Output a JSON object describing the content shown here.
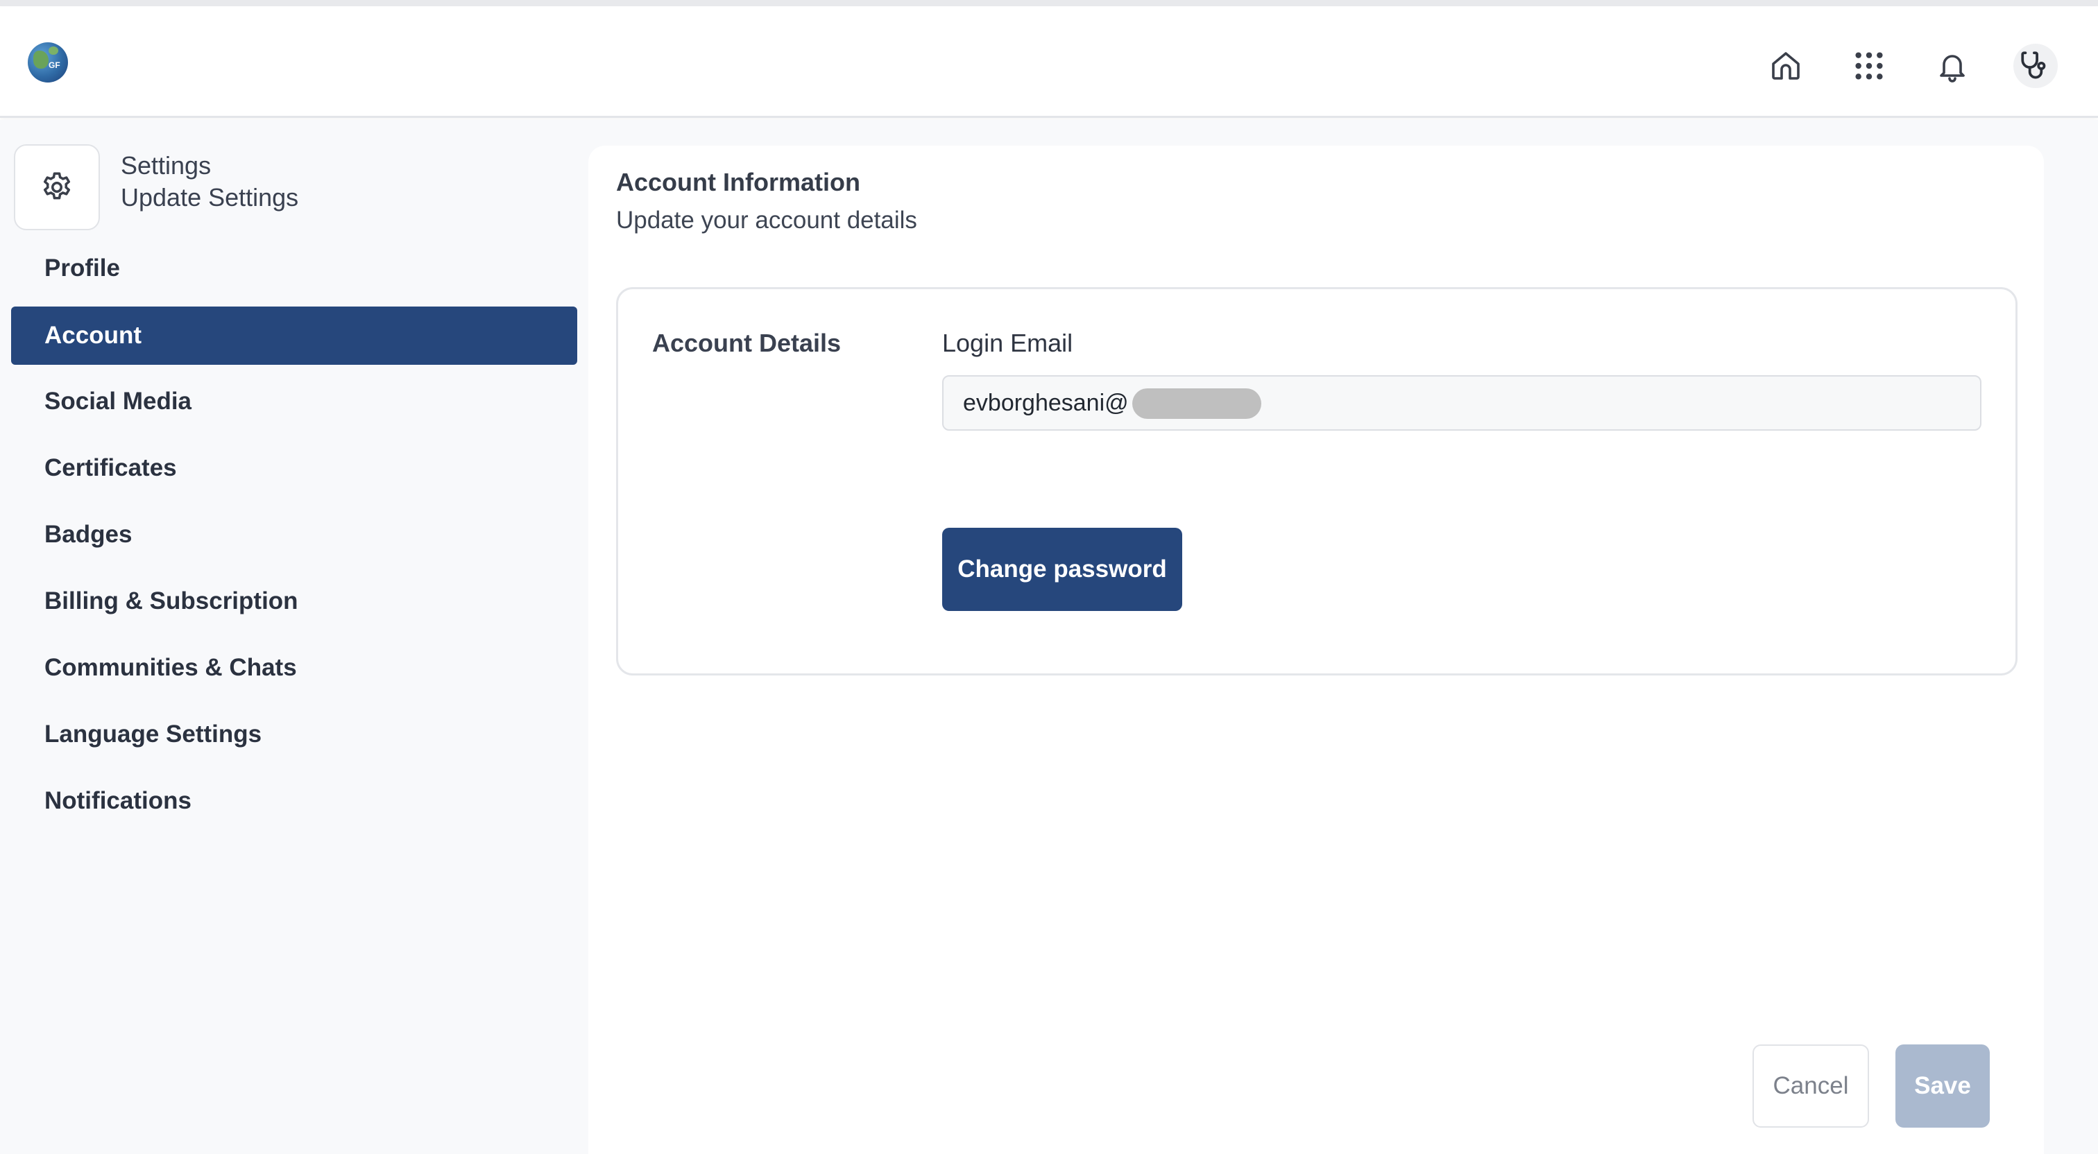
{
  "header": {
    "logo": {
      "icon": "globe-logo-icon",
      "mark": "GF"
    },
    "icons": [
      "home-icon",
      "apps-grid-icon",
      "bell-icon",
      "stethoscope-avatar-icon"
    ]
  },
  "sidebar": {
    "title": "Settings",
    "subtitle": "Update Settings",
    "header_icon": "gear-icon",
    "items": [
      {
        "label": "Profile"
      },
      {
        "label": "Account",
        "active": true
      },
      {
        "label": "Social Media"
      },
      {
        "label": "Certificates"
      },
      {
        "label": "Badges"
      },
      {
        "label": "Billing & Subscription"
      },
      {
        "label": "Communities & Chats"
      },
      {
        "label": "Language Settings"
      },
      {
        "label": "Notifications"
      }
    ]
  },
  "main": {
    "title": "Account Information",
    "subtitle": "Update your account details",
    "section_label": "Account Details",
    "email_label": "Login Email",
    "email_value": "evborghesani@",
    "change_password_label": "Change password",
    "cancel_label": "Cancel",
    "save_label": "Save"
  },
  "colors": {
    "accent": "#26477c",
    "save_disabled": "#aab9cf",
    "page_bg": "#f8f9fb"
  }
}
